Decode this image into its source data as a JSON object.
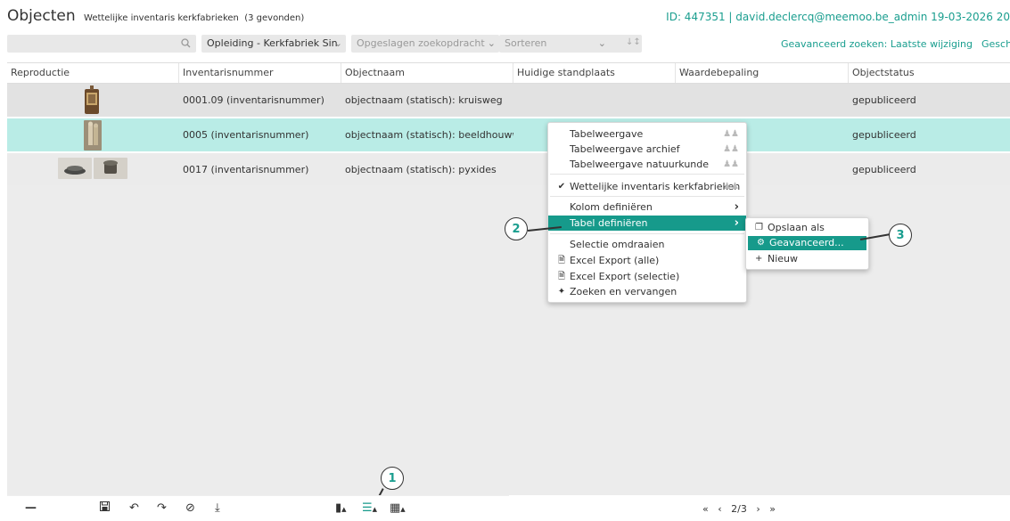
{
  "header": {
    "title": "Objecten",
    "subtitle": "Wettelijke inventaris kerkfabrieken",
    "count": "(3 gevonden)",
    "user_info": "ID: 447351 | david.declercq@meemoo.be_admin 19-03-2026 20"
  },
  "toolbar": {
    "search_placeholder": "",
    "opleiding_value": "Opleiding - Kerkfabriek Sin",
    "zoekopdracht_placeholder": "Opgeslagen zoekopdracht",
    "sorteren_placeholder": "Sorteren",
    "advanced_search_link": "Geavanceerd zoeken: Laatste wijziging",
    "history_link": "Geschiede"
  },
  "table": {
    "columns": [
      "Reproductie",
      "Inventarisnummer",
      "Objectnaam",
      "Huidige standplaats",
      "Waardebepaling",
      "Objectstatus"
    ],
    "rows": [
      {
        "inventarisnummer": "0001.09 (inventarisnummer)",
        "objectnaam": "objectnaam (statisch): kruisweg",
        "standplaats": "",
        "waarde": "",
        "status": "gepubliceerd"
      },
      {
        "inventarisnummer": "0005 (inventarisnummer)",
        "objectnaam": "objectnaam (statisch): beeldhouwwerk",
        "standplaats": "",
        "waarde": "",
        "status": "gepubliceerd"
      },
      {
        "inventarisnummer": "0017 (inventarisnummer)",
        "objectnaam": "objectnaam (statisch): pyxides",
        "standplaats": "",
        "waarde": "",
        "status": "gepubliceerd"
      }
    ]
  },
  "context_menu": {
    "items": [
      {
        "label": "Tabelweergave"
      },
      {
        "label": "Tabelweergave archief"
      },
      {
        "label": "Tabelweergave natuurkunde"
      },
      {
        "label": "Wettelijke inventaris kerkfabrieken"
      },
      {
        "label": "Kolom definiëren"
      },
      {
        "label": "Tabel definiëren"
      },
      {
        "label": "Selectie omdraaien"
      },
      {
        "label": "Excel Export (alle)"
      },
      {
        "label": "Excel Export (selectie)"
      },
      {
        "label": "Zoeken en vervangen"
      }
    ]
  },
  "submenu": {
    "items": [
      {
        "label": "Opslaan als"
      },
      {
        "label": "Geavanceerd..."
      },
      {
        "label": "Nieuw"
      }
    ]
  },
  "callouts": [
    "1",
    "2",
    "3"
  ],
  "pager": {
    "page": "2/3"
  },
  "colors": {
    "accent": "#169a8b",
    "selected_row": "#b9ece6"
  }
}
